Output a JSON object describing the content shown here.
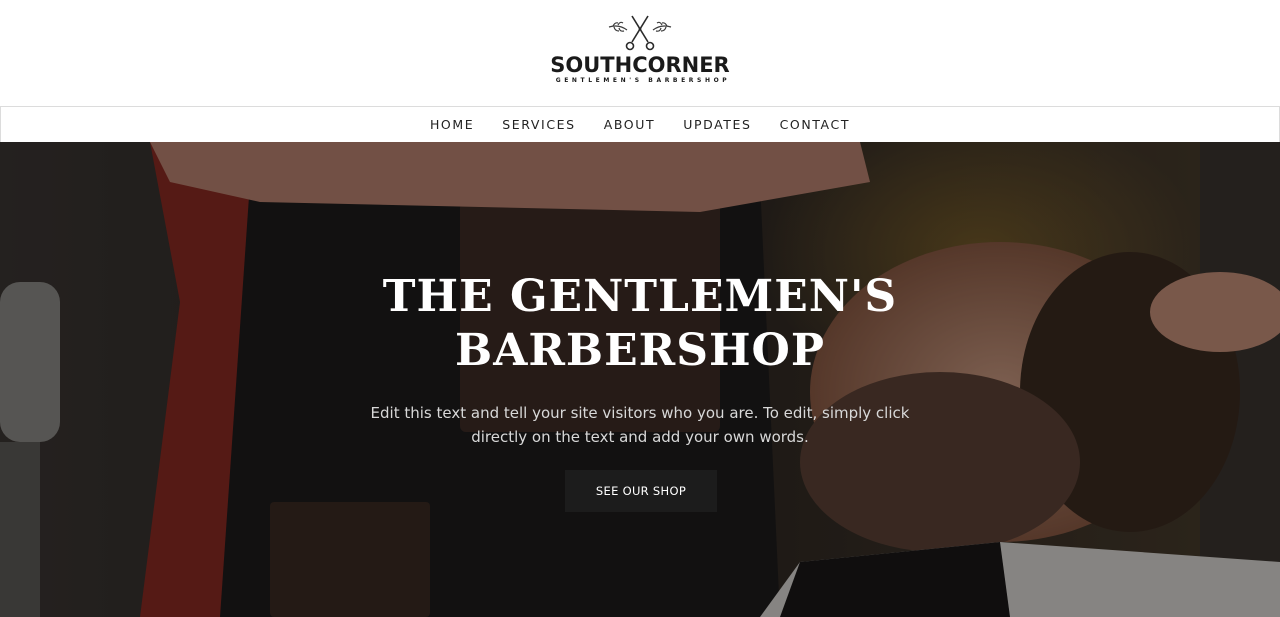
{
  "brand": {
    "name": "SOUTHCORNER",
    "tagline": "GENTLEMEN'S BARBERSHOP",
    "logo_icon": "crossed-scissors-icon"
  },
  "nav": {
    "items": [
      {
        "label": "HOME"
      },
      {
        "label": "SERVICES"
      },
      {
        "label": "ABOUT"
      },
      {
        "label": "UPDATES"
      },
      {
        "label": "CONTACT"
      }
    ]
  },
  "hero": {
    "title_line1": "THE GENTLEMEN'S",
    "title_line2": "BARBERSHOP",
    "text": "Edit this text and tell your site visitors who you are. To edit, simply click directly on the text and add your own words.",
    "button_label": "SEE OUR SHOP",
    "image_subject": "barber-shaving-customer-photo"
  },
  "colors": {
    "header_bg": "#ffffff",
    "nav_border": "#dcdcdc",
    "text_dark": "#222222",
    "button_bg": "#1c1c1c",
    "hero_text": "#d8d8d8"
  }
}
